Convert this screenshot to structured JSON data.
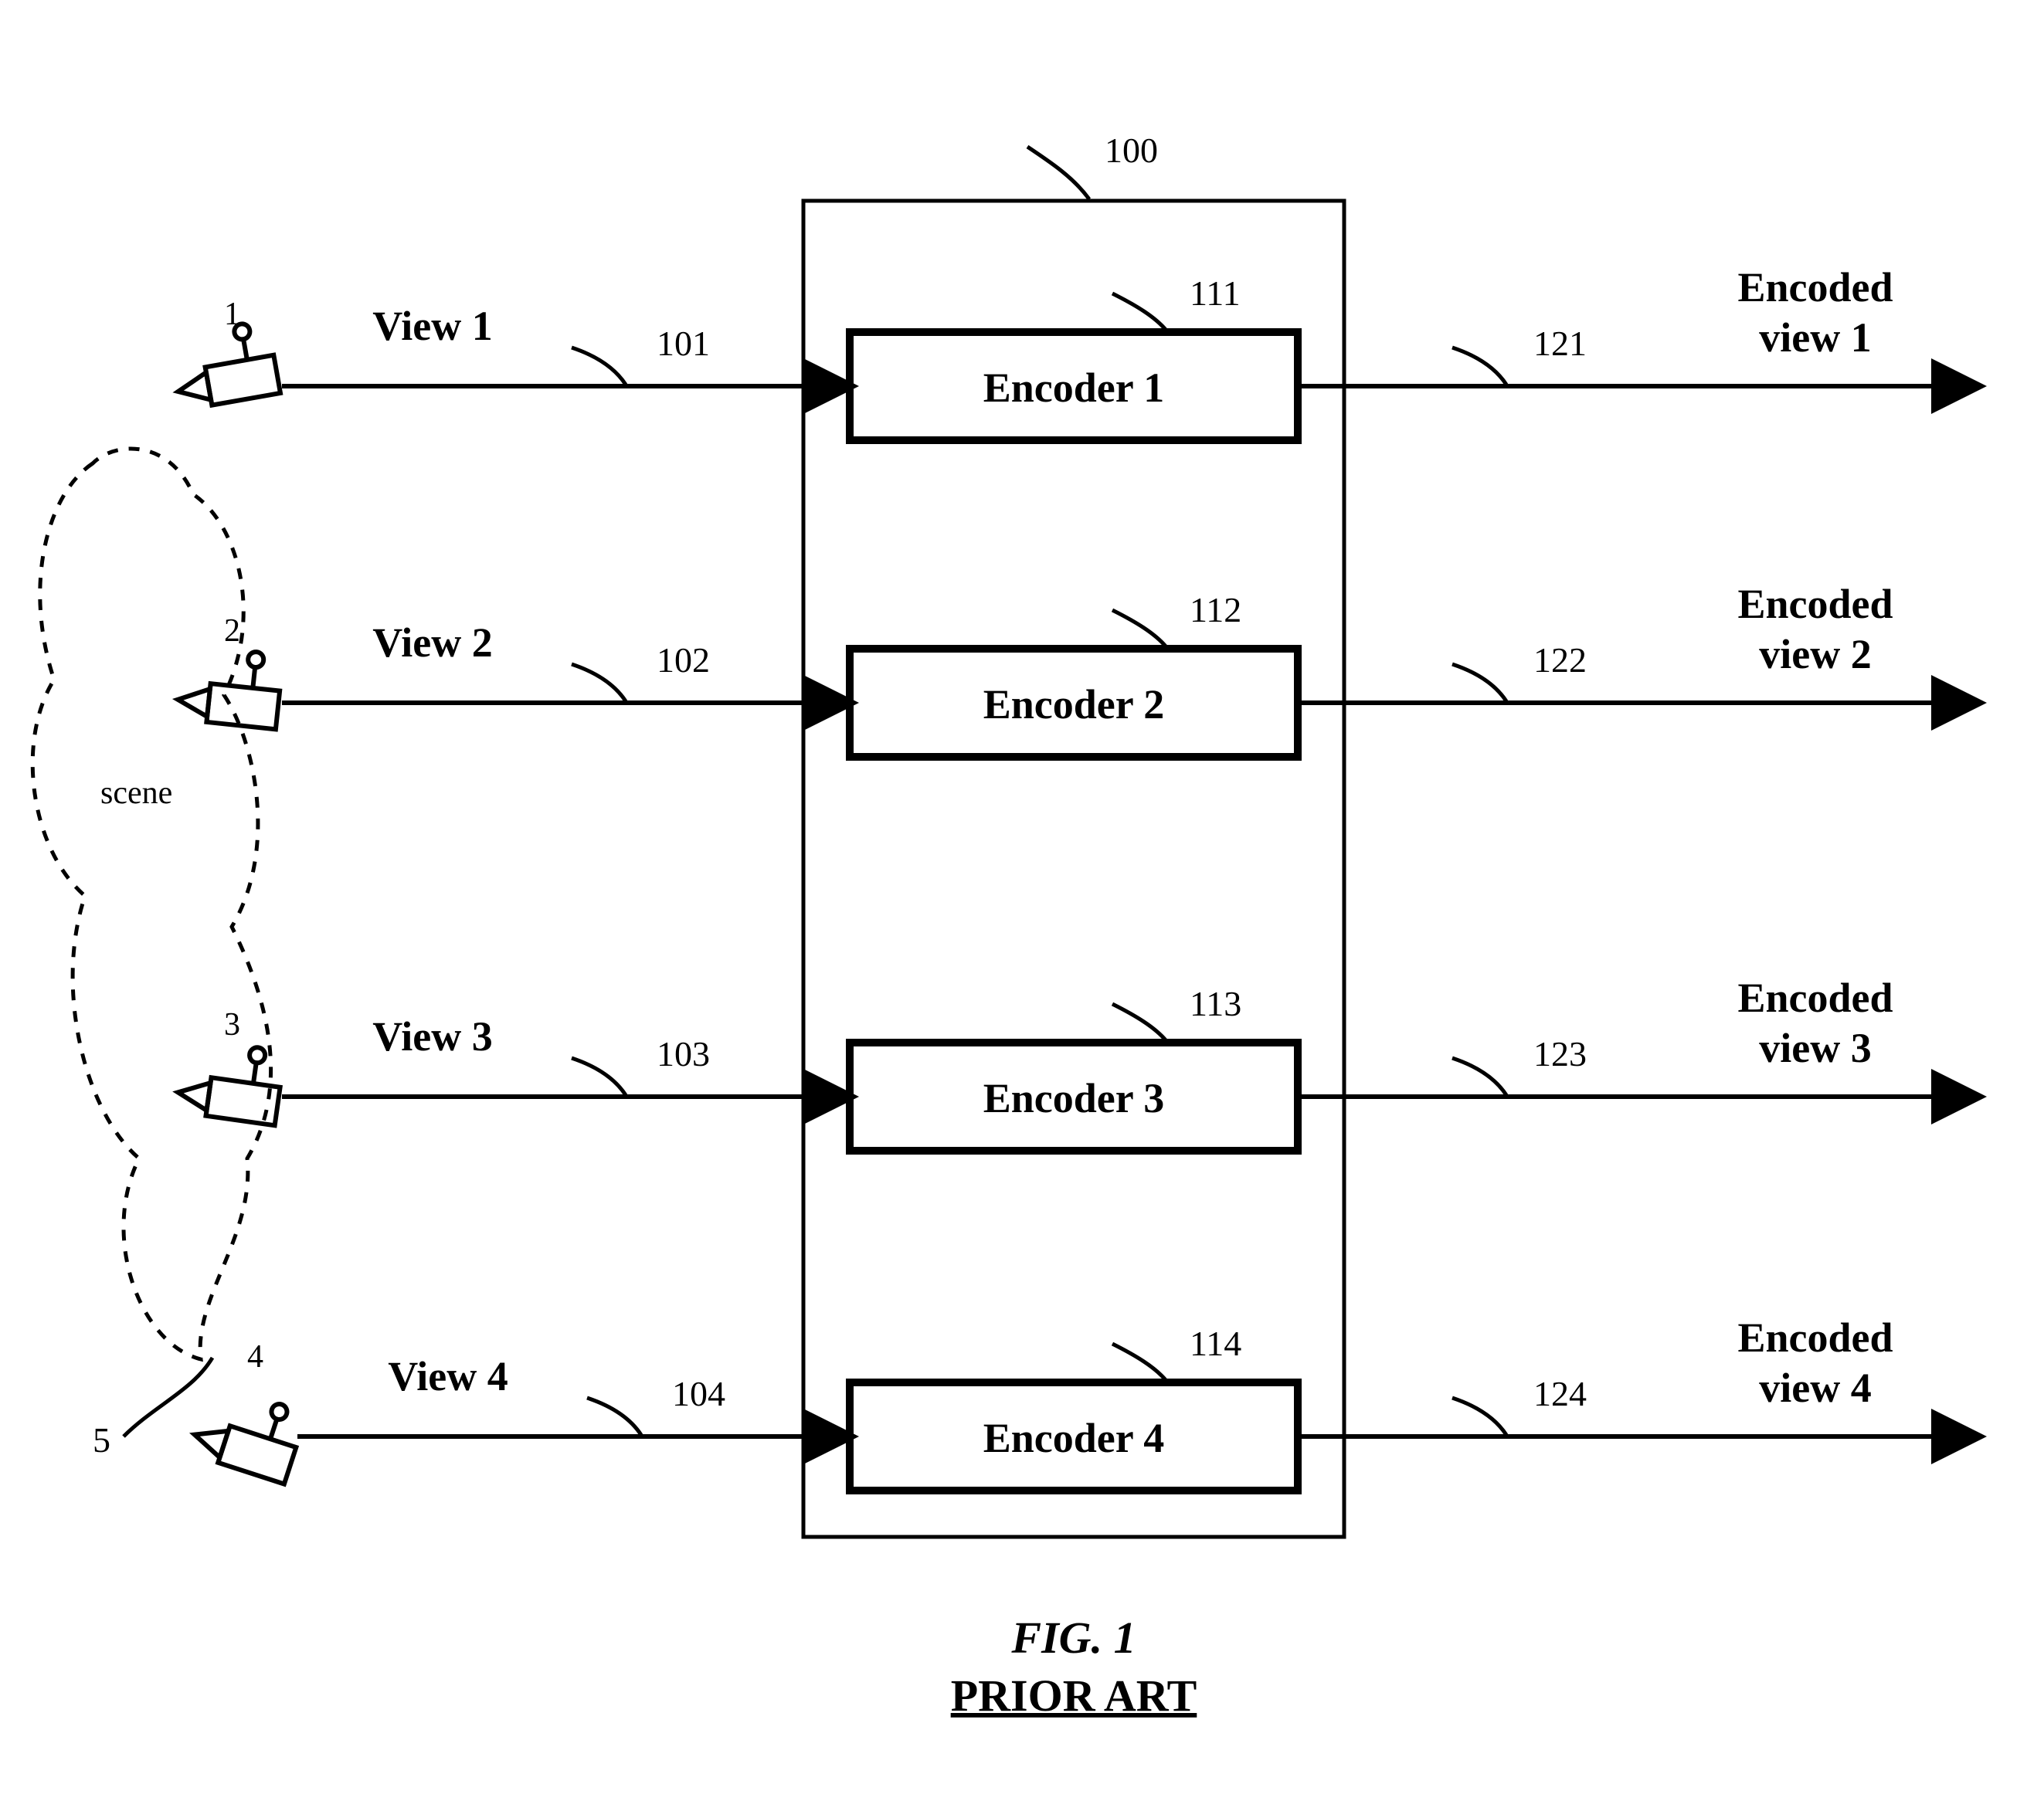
{
  "scene": {
    "label": "scene",
    "ref": "5"
  },
  "encoder_block_ref": "100",
  "rows": [
    {
      "camera_ref": "1",
      "view_label": "View 1",
      "in_ref": "101",
      "encoder_label": "Encoder 1",
      "encoder_ref": "111",
      "out_ref": "121",
      "output_l1": "Encoded",
      "output_l2": "view 1"
    },
    {
      "camera_ref": "2",
      "view_label": "View 2",
      "in_ref": "102",
      "encoder_label": "Encoder 2",
      "encoder_ref": "112",
      "out_ref": "122",
      "output_l1": "Encoded",
      "output_l2": "view 2"
    },
    {
      "camera_ref": "3",
      "view_label": "View 3",
      "in_ref": "103",
      "encoder_label": "Encoder 3",
      "encoder_ref": "113",
      "out_ref": "123",
      "output_l1": "Encoded",
      "output_l2": "view 3"
    },
    {
      "camera_ref": "4",
      "view_label": "View 4",
      "in_ref": "104",
      "encoder_label": "Encoder 4",
      "encoder_ref": "114",
      "out_ref": "124",
      "output_l1": "Encoded",
      "output_l2": "view 4"
    }
  ],
  "figure": {
    "title": "FIG. 1",
    "subtitle": "PRIOR ART"
  }
}
